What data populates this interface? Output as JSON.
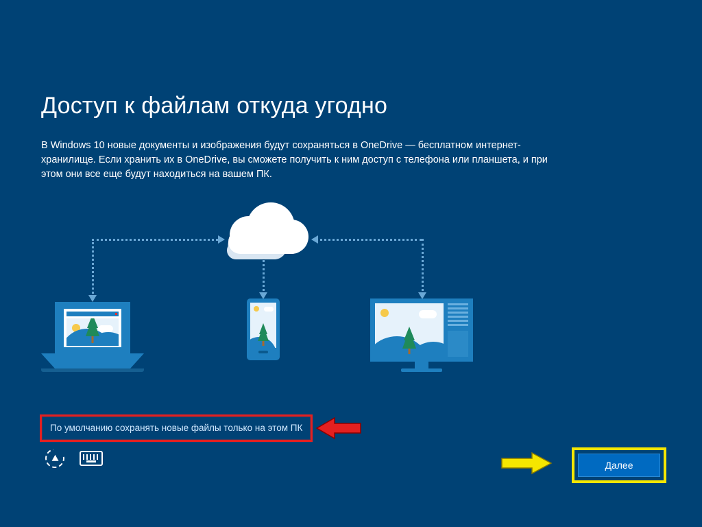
{
  "title": "Доступ к файлам откуда угодно",
  "description": "В Windows 10 новые документы и изображения будут сохраняться в OneDrive — бесплатном интернет-хранилище. Если хранить их в OneDrive, вы сможете получить к ним доступ с телефона или планшета, и при этом они все еще будут находиться на вашем ПК.",
  "local_only_link": "По умолчанию сохранять новые файлы только на этом ПК",
  "next_button": "Далее"
}
